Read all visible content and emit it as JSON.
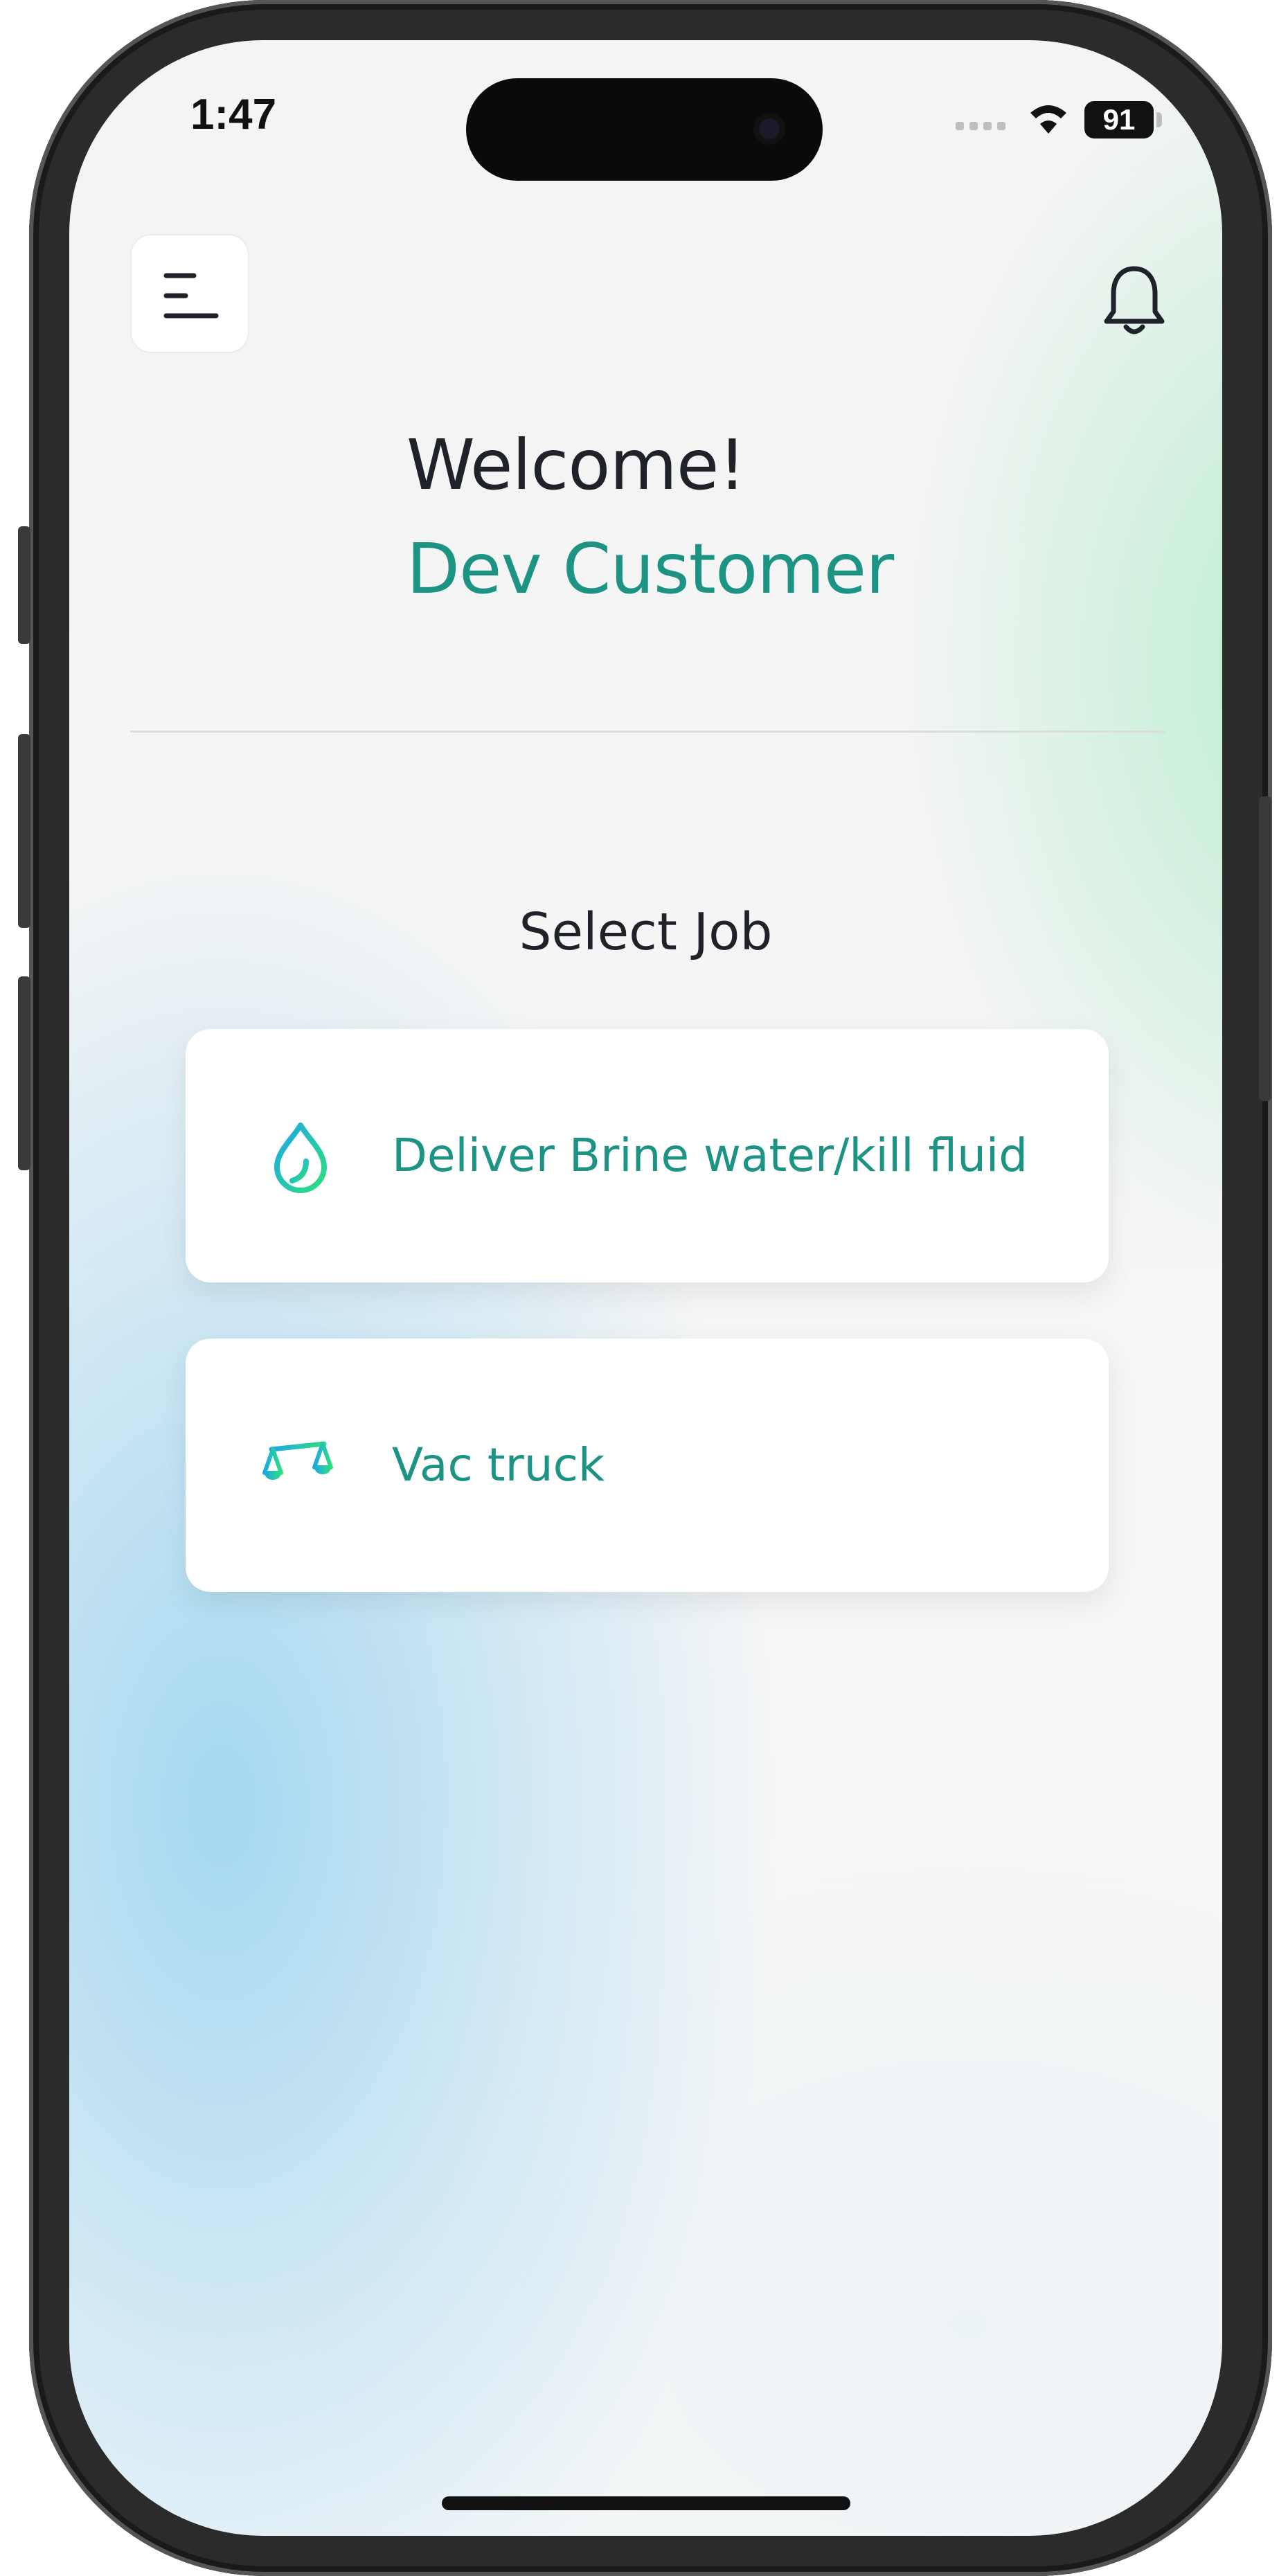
{
  "status_bar": {
    "time": "1:47",
    "battery": "91"
  },
  "header": {
    "menu_icon": "menu-icon",
    "notification_icon": "bell-icon"
  },
  "greeting": {
    "welcome": "Welcome!",
    "name": "Dev Customer"
  },
  "jobs": {
    "title": "Select Job",
    "items": [
      {
        "label": "Deliver Brine water/kill fluid",
        "icon": "water-drop-icon"
      },
      {
        "label": "Vac truck",
        "icon": "scale-icon"
      }
    ]
  },
  "colors": {
    "accent": "#1d9384",
    "text": "#1f2329",
    "icon_gradient_start": "#1ea7e6",
    "icon_gradient_end": "#2de07e"
  }
}
